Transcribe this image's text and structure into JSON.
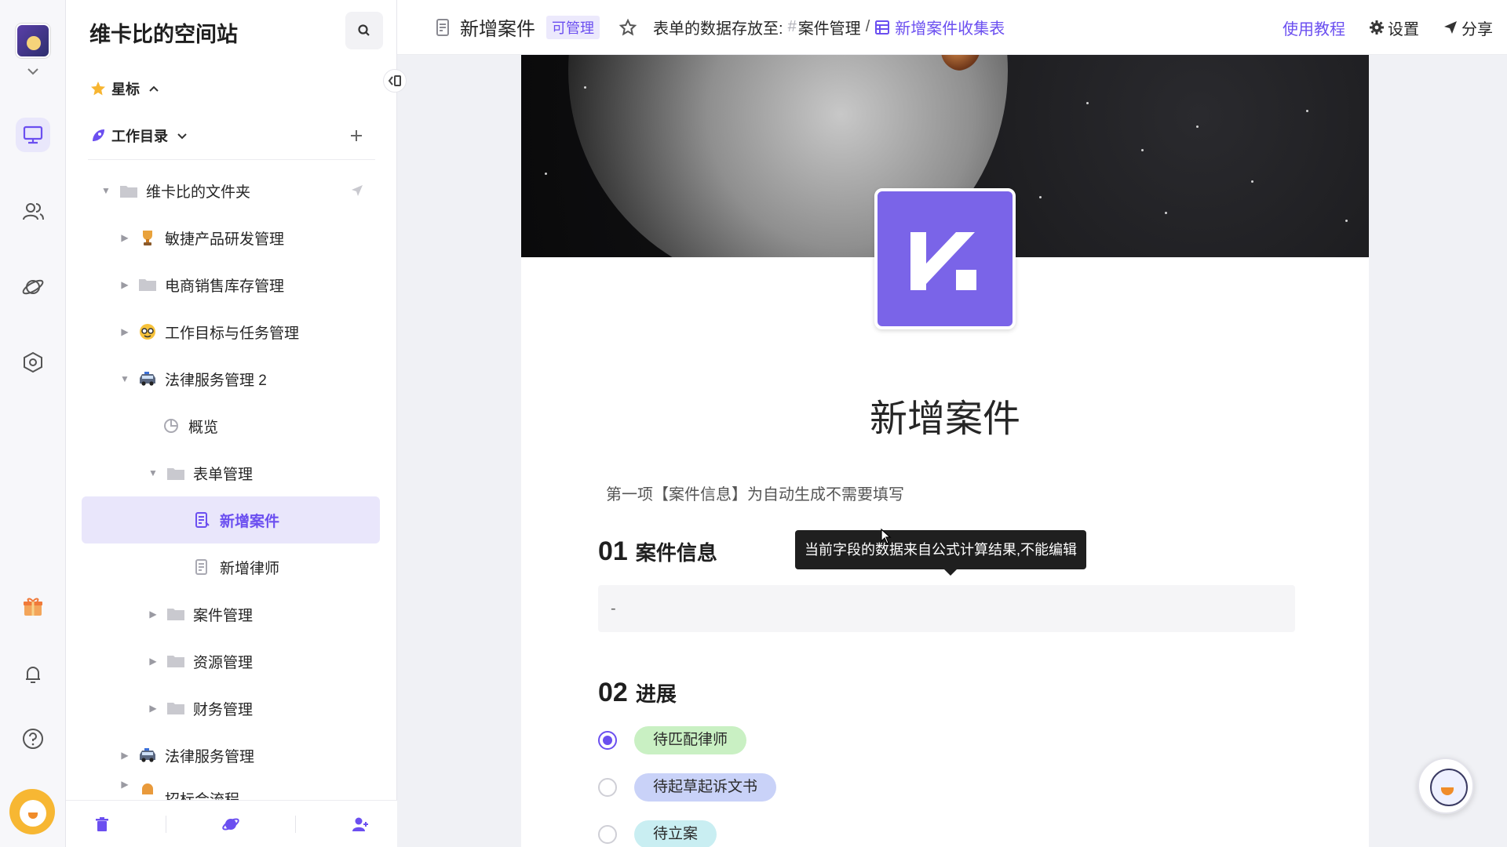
{
  "workspace": {
    "title": "维卡比的空间站"
  },
  "sidebar": {
    "starred_label": "星标",
    "catalog_label": "工作目录",
    "tree": [
      {
        "label": "维卡比的文件夹",
        "icon": "folder-icon",
        "expanded": true
      },
      {
        "label": "敏捷产品研发管理",
        "icon": "trophy-icon",
        "expanded": false
      },
      {
        "label": "电商销售库存管理",
        "icon": "folder-icon",
        "expanded": false
      },
      {
        "label": "工作目标与任务管理",
        "icon": "nerd-face-icon",
        "expanded": false
      },
      {
        "label": "法律服务管理 2",
        "icon": "police-car-icon",
        "expanded": true
      },
      {
        "label": "概览",
        "icon": "dashboard-icon"
      },
      {
        "label": "表单管理",
        "icon": "folder-icon",
        "expanded": true
      },
      {
        "label": "新增案件",
        "icon": "form-icon",
        "selected": true
      },
      {
        "label": "新增律师",
        "icon": "form-icon"
      },
      {
        "label": "案件管理",
        "icon": "folder-icon",
        "expanded": false
      },
      {
        "label": "资源管理",
        "icon": "folder-icon",
        "expanded": false
      },
      {
        "label": "财务管理",
        "icon": "folder-icon",
        "expanded": false
      },
      {
        "label": "法律服务管理",
        "icon": "police-car-icon",
        "expanded": false
      }
    ],
    "cut_off_label": "招标会流程"
  },
  "topbar": {
    "title": "新增案件",
    "badge": "可管理",
    "store_prefix": "表单的数据存放至:",
    "store_hash": "#",
    "store_crumb": "案件管理",
    "store_sep": "/",
    "store_link": "新增案件收集表",
    "tutorial": "使用教程",
    "settings": "设置",
    "share": "分享"
  },
  "form": {
    "title": "新增案件",
    "description": "第一项【案件信息】为自动生成不需要填写",
    "q1": {
      "num": "01",
      "label": "案件信息",
      "value": "-"
    },
    "tooltip": "当前字段的数据来自公式计算结果,不能编辑",
    "q2": {
      "num": "02",
      "label": "进展",
      "options": [
        {
          "label": "待匹配律师",
          "color": "#c9f0c3",
          "checked": true
        },
        {
          "label": "待起草起诉文书",
          "color": "#c9d2f8",
          "checked": false
        },
        {
          "label": "待立案",
          "color": "#c9eef2",
          "checked": false
        }
      ]
    }
  },
  "colors": {
    "accent": "#6b4ff0",
    "logo": "#7a64e8"
  }
}
